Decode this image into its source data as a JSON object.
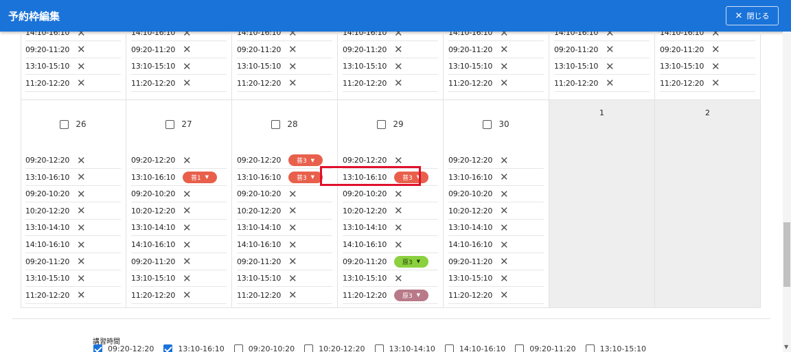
{
  "header": {
    "title": "予約枠編集",
    "close_label": "閉じる"
  },
  "prev_week": [
    {
      "slots": [
        "14:10-16:10",
        "09:20-11:20",
        "13:10-15:10",
        "11:20-12:20"
      ]
    },
    {
      "slots": [
        "14:10-16:10",
        "09:20-11:20",
        "13:10-15:10",
        "11:20-12:20"
      ]
    },
    {
      "slots": [
        "14:10-16:10",
        "09:20-11:20",
        "13:10-15:10",
        "11:20-12:20"
      ]
    },
    {
      "slots": [
        "14:10-16:10",
        "09:20-11:20",
        "13:10-15:10",
        "11:20-12:20"
      ]
    },
    {
      "slots": [
        "14:10-16:10",
        "09:20-11:20",
        "13:10-15:10",
        "11:20-12:20"
      ]
    },
    {
      "slots": [
        "14:10-16:10",
        "09:20-11:20",
        "13:10-15:10",
        "11:20-12:20"
      ]
    },
    {
      "slots": [
        "14:10-16:10",
        "09:20-11:20",
        "13:10-15:10",
        "11:20-12:20"
      ]
    }
  ],
  "week": [
    {
      "day": "26",
      "slots": [
        {
          "time": "09:20-12:20"
        },
        {
          "time": "13:10-16:10"
        },
        {
          "time": "09:20-10:20"
        },
        {
          "time": "10:20-12:20"
        },
        {
          "time": "13:10-14:10"
        },
        {
          "time": "14:10-16:10"
        },
        {
          "time": "09:20-11:20"
        },
        {
          "time": "13:10-15:10"
        },
        {
          "time": "11:20-12:20"
        }
      ]
    },
    {
      "day": "27",
      "slots": [
        {
          "time": "09:20-12:20"
        },
        {
          "time": "13:10-16:10",
          "badge": "普1",
          "color": "red"
        },
        {
          "time": "09:20-10:20"
        },
        {
          "time": "10:20-12:20"
        },
        {
          "time": "13:10-14:10"
        },
        {
          "time": "14:10-16:10"
        },
        {
          "time": "09:20-11:20"
        },
        {
          "time": "13:10-15:10"
        },
        {
          "time": "11:20-12:20"
        }
      ]
    },
    {
      "day": "28",
      "slots": [
        {
          "time": "09:20-12:20",
          "badge": "普3",
          "color": "red"
        },
        {
          "time": "13:10-16:10",
          "badge": "普3",
          "color": "red"
        },
        {
          "time": "09:20-10:20"
        },
        {
          "time": "10:20-12:20"
        },
        {
          "time": "13:10-14:10"
        },
        {
          "time": "14:10-16:10"
        },
        {
          "time": "09:20-11:20"
        },
        {
          "time": "13:10-15:10"
        },
        {
          "time": "11:20-12:20"
        }
      ]
    },
    {
      "day": "29",
      "slots": [
        {
          "time": "09:20-12:20"
        },
        {
          "time": "13:10-16:10",
          "badge": "普3",
          "color": "red"
        },
        {
          "time": "09:20-10:20"
        },
        {
          "time": "10:20-12:20"
        },
        {
          "time": "13:10-14:10"
        },
        {
          "time": "14:10-16:10"
        },
        {
          "time": "09:20-11:20",
          "badge": "原3",
          "color": "green"
        },
        {
          "time": "13:10-15:10"
        },
        {
          "time": "11:20-12:20",
          "badge": "原3",
          "color": "mauve"
        }
      ]
    },
    {
      "day": "30",
      "slots": [
        {
          "time": "09:20-12:20"
        },
        {
          "time": "13:10-16:10"
        },
        {
          "time": "09:20-10:20"
        },
        {
          "time": "10:20-12:20"
        },
        {
          "time": "13:10-14:10"
        },
        {
          "time": "14:10-16:10"
        },
        {
          "time": "09:20-11:20"
        },
        {
          "time": "13:10-15:10"
        },
        {
          "time": "11:20-12:20"
        }
      ]
    }
  ],
  "next_month_days": [
    "1",
    "2"
  ],
  "lecture_filter": {
    "label": "講習時間",
    "options": [
      {
        "label": "09:20-12:20",
        "checked": true
      },
      {
        "label": "13:10-16:10",
        "checked": true
      },
      {
        "label": "09:20-10:20",
        "checked": false
      },
      {
        "label": "10:20-12:20",
        "checked": false
      },
      {
        "label": "13:10-14:10",
        "checked": false
      },
      {
        "label": "14:10-16:10",
        "checked": false
      },
      {
        "label": "09:20-11:20",
        "checked": false
      },
      {
        "label": "13:10-15:10",
        "checked": false
      }
    ]
  },
  "icons": {
    "close": "close-icon",
    "delete": "x-icon",
    "dropdown": "caret-down-icon",
    "checkbox": "checkbox-icon"
  },
  "colors": {
    "header": "#1a73d9",
    "badge_red": "#e8604c",
    "badge_green": "#8bd13f",
    "badge_mauve": "#b87a88",
    "highlight": "#e0102a"
  }
}
